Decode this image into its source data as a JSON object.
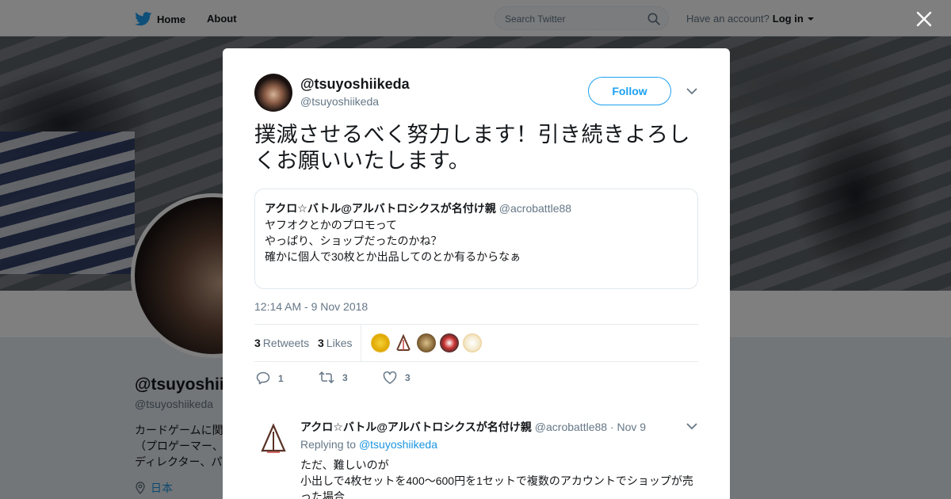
{
  "nav": {
    "home_label": "Home",
    "about_label": "About",
    "search_placeholder": "Search Twitter",
    "account_prompt": "Have an account?",
    "login_label": "Log in"
  },
  "background_profile": {
    "name": "@tsuyoshiikeda",
    "handle": "@tsuyoshiikeda",
    "bio_lines": [
      "カードゲームに関",
      "（プロゲーマー、",
      "ディレクター、パ"
    ],
    "location": "日本"
  },
  "tweet": {
    "author_name": "@tsuyoshiikeda",
    "author_handle": "@tsuyoshiikeda",
    "follow_label": "Follow",
    "text": "撲滅させるべく努力します！引き続きよろしくお願いいたします。",
    "quote": {
      "name": "アクロ☆バトル@アルバトロシクスが名付け親",
      "handle": "@acrobattle88",
      "lines": [
        "ヤフオクとかのプロモって",
        "やっぱり、ショップだったのかね？",
        "確かに個人で30枚とか出品してのとか有るからなぁ"
      ]
    },
    "timestamp": "12:14 AM - 9 Nov 2018",
    "retweets_count": "3",
    "retweets_label": "Retweets",
    "likes_count": "3",
    "likes_label": "Likes",
    "actions": {
      "reply_count": "1",
      "retweet_count": "3",
      "like_count": "3"
    }
  },
  "reply": {
    "name": "アクロ☆バトル@アルバトロシクスが名付け親",
    "meta": "@acrobattle88 · Nov 9",
    "replying_prefix": "Replying to",
    "replying_to": "@tsuyoshiikeda",
    "lines": [
      "ただ、難しいのが",
      "小出しで4枚セットを400～600円を1セットで複数のアカウントでショップが売",
      "った場合"
    ]
  },
  "colors": {
    "brand": "#1da1f2",
    "link": "#1b95e0",
    "muted": "#657786",
    "text": "#14171a"
  }
}
